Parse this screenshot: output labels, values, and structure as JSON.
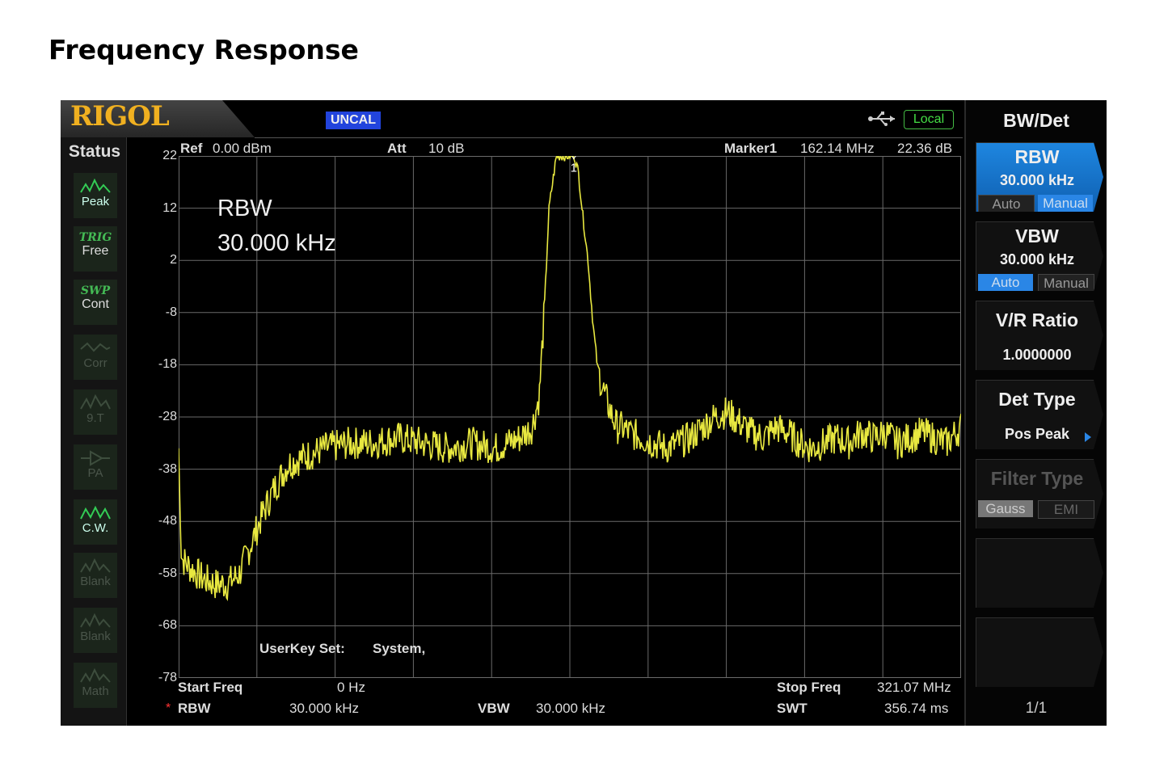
{
  "page_title": "Frequency Response",
  "header": {
    "logo": "RIGOL",
    "uncal_badge": "UNCAL",
    "local_badge": "Local"
  },
  "status": {
    "title": "Status",
    "buttons": [
      {
        "label": "Peak",
        "state": "on",
        "icon": "peak-icon"
      },
      {
        "top": "TRIG",
        "label": "Free",
        "state": "on"
      },
      {
        "top": "SWP",
        "label": "Cont",
        "state": "on"
      },
      {
        "label": "Corr",
        "state": "off",
        "icon": "corr-icon"
      },
      {
        "label": "9.T",
        "state": "off",
        "icon": "trace-icon"
      },
      {
        "label": "PA",
        "state": "off",
        "icon": "pa-icon"
      },
      {
        "label": "C.W.",
        "state": "on",
        "icon": "cw-icon"
      },
      {
        "label": "Blank",
        "state": "off",
        "icon": "blank-icon"
      },
      {
        "label": "Blank",
        "state": "off",
        "icon": "blank-icon"
      },
      {
        "label": "Math",
        "state": "off",
        "icon": "math-icon"
      }
    ]
  },
  "screen": {
    "ref_label": "Ref",
    "ref_value": "0.00 dBm",
    "att_label": "Att",
    "att_value": "10 dB",
    "marker_label": "Marker1",
    "marker_freq": "162.14 MHz",
    "marker_level": "22.36 dB",
    "marker_number": "1",
    "overlay_line1": "RBW",
    "overlay_line2": "30.000 kHz",
    "userkey_label": "UserKey Set:",
    "userkey_value": "System,",
    "start_freq_label": "Start Freq",
    "start_freq_value": "0 Hz",
    "stop_freq_label": "Stop Freq",
    "stop_freq_value": "321.07 MHz",
    "rbw_star": "*",
    "rbw_label": "RBW",
    "rbw_value": "30.000 kHz",
    "vbw_label": "VBW",
    "vbw_value": "30.000 kHz",
    "swt_label": "SWT",
    "swt_value": "356.74 ms"
  },
  "menu": {
    "title": "BW/Det",
    "rbw": {
      "title": "RBW",
      "value": "30.000 kHz",
      "auto": "Auto",
      "manual": "Manual"
    },
    "vbw": {
      "title": "VBW",
      "value": "30.000 kHz",
      "auto": "Auto",
      "manual": "Manual"
    },
    "vr_ratio": {
      "title": "V/R Ratio",
      "value": "1.0000000"
    },
    "det_type": {
      "title": "Det Type",
      "value": "Pos Peak"
    },
    "filter_type": {
      "title": "Filter Type",
      "gauss": "Gauss",
      "emi": "EMI"
    },
    "page": "1/1"
  },
  "colors": {
    "trace": "#e8e840",
    "grid": "#6a6a6a",
    "accent_blue": "#1e86e0",
    "logo_gold": "#f0b020"
  },
  "chart_data": {
    "type": "line",
    "x_unit": "MHz",
    "y_unit": "dBm",
    "ylim": [
      -78,
      22
    ],
    "xlim": [
      0,
      321.07
    ],
    "y_ticks": [
      22,
      12,
      2,
      -8,
      -18,
      -28,
      -38,
      -48,
      -58,
      -68,
      -78
    ],
    "grid": true,
    "series": [
      {
        "x": [
          0,
          1,
          5,
          10,
          15,
          20,
          25,
          30,
          35,
          40,
          45,
          50,
          55,
          60,
          70,
          80,
          90,
          100,
          110,
          120,
          130,
          135,
          140,
          145,
          148,
          150,
          152,
          155,
          158,
          160,
          162.14,
          164,
          166,
          168,
          170,
          172,
          175,
          178,
          180,
          182,
          185,
          190,
          195,
          200,
          205,
          210,
          215,
          220,
          225,
          230,
          235,
          240,
          245,
          250,
          255,
          260,
          265,
          270,
          275,
          280,
          285,
          290,
          295,
          300,
          305,
          310,
          315,
          321.07
        ],
        "y": [
          -34,
          -55,
          -57,
          -59,
          -60,
          -60,
          -58,
          -52,
          -46,
          -41,
          -37,
          -36,
          -35,
          -34,
          -33,
          -33,
          -32,
          -33,
          -34,
          -33,
          -34,
          -33,
          -32,
          -30,
          -24,
          -8,
          12,
          22,
          22,
          22,
          22.36,
          19,
          10,
          2,
          -10,
          -19,
          -24,
          -28,
          -30,
          -30,
          -31,
          -32,
          -33,
          -34,
          -33,
          -32,
          -30,
          -28,
          -27,
          -29,
          -31,
          -32,
          -30,
          -31,
          -33,
          -34,
          -33,
          -32,
          -33,
          -31,
          -32,
          -31,
          -33,
          -32,
          -31,
          -32,
          -33,
          -30
        ]
      }
    ]
  }
}
